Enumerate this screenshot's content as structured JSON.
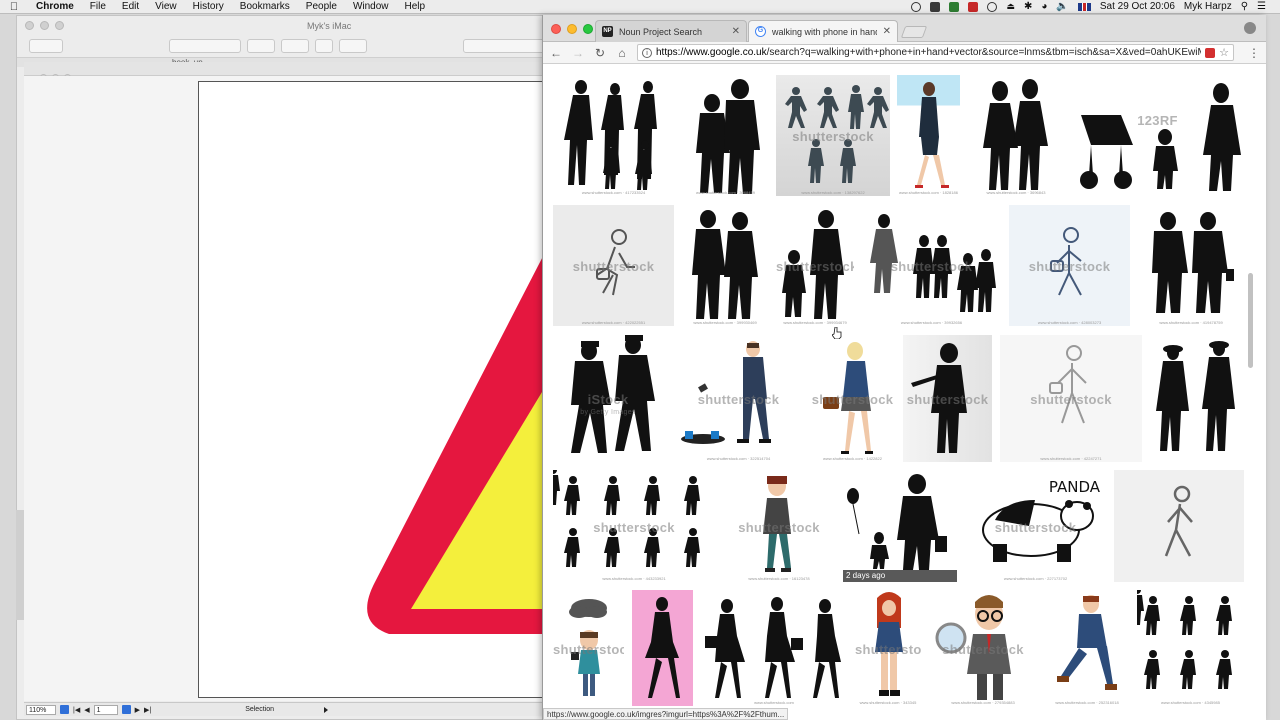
{
  "menubar": {
    "app": "Chrome",
    "items": [
      "File",
      "Edit",
      "View",
      "History",
      "Bookmarks",
      "People",
      "Window",
      "Help"
    ],
    "clock": "Sat 29 Oct  20:06",
    "user": "Myk Harpz"
  },
  "editor": {
    "window_caption": "Myk's iMac",
    "tab_label": "book_up",
    "zoom": "110%",
    "page": "1",
    "tool": "Selection",
    "colors": {
      "triangle_border": "#e5173f",
      "triangle_fill": "#f4ef3c"
    }
  },
  "chrome": {
    "tabs": [
      {
        "label": "Noun Project Search",
        "favicon": "noun-project-icon"
      },
      {
        "label": "walking with phone in hand ve",
        "favicon": "google-icon"
      }
    ],
    "url_host": "https://www.google.co.uk",
    "url_path": "/search?q=walking+with+phone+in+hand+vector&source=lnms&tbm=isch&sa=X&ved=0ahUKEwiMtMfR...",
    "status_url": "https://www.google.co.uk/imgres?imgurl=https%3A%2F%2Fthum..."
  },
  "results": {
    "watermarks": {
      "shutterstock": "shutterstock",
      "istock": "iStock",
      "istock_sub": "by Getty Images",
      "rf": "123RF"
    },
    "badge_text": "2 days ago",
    "panda_label": "PANDA",
    "captions": {
      "r1c1": "www.shutterstock.com · 417233524",
      "r1c2": "www.shutterstock.com · 3068459",
      "r1c3": "www.shutterstock.com · 138297622",
      "r1c4": "www.shutterstock.com · 1828186",
      "r1c5": "www.shutterstock.com · 3696843",
      "r2c1": "www.shutterstock.com · 422022551",
      "r2c2": "www.shutterstock.com · 399930469",
      "r2c3": "www.shutterstock.com · 399934679",
      "r2c4": "www.shutterstock.com · 39932656",
      "r2c5": "www.shutterstock.com · 428003273",
      "r2c6": "www.shutterstock.com · 419478759",
      "r3c2": "www.shutterstock.com · 322514704",
      "r3c3": "www.shutterstock.com · 1422822",
      "r3c5": "www.shutterstock.com · 42247271",
      "r4c1": "www.shutterstock.com · 443233921",
      "r4c2": "www.shutterstock.com · 16123478",
      "r4c4": "www.shutterstock.com · 227173702",
      "r5c3": "www.shutterstock.com",
      "r5c4": "www.shutterstock.com · 343345",
      "r5c5": "www.shutterstock.com · 279354883",
      "r5c6": "www.shutterstock.com · 252316018",
      "r5c7": "www.shutterstock.com · 4345985"
    }
  }
}
